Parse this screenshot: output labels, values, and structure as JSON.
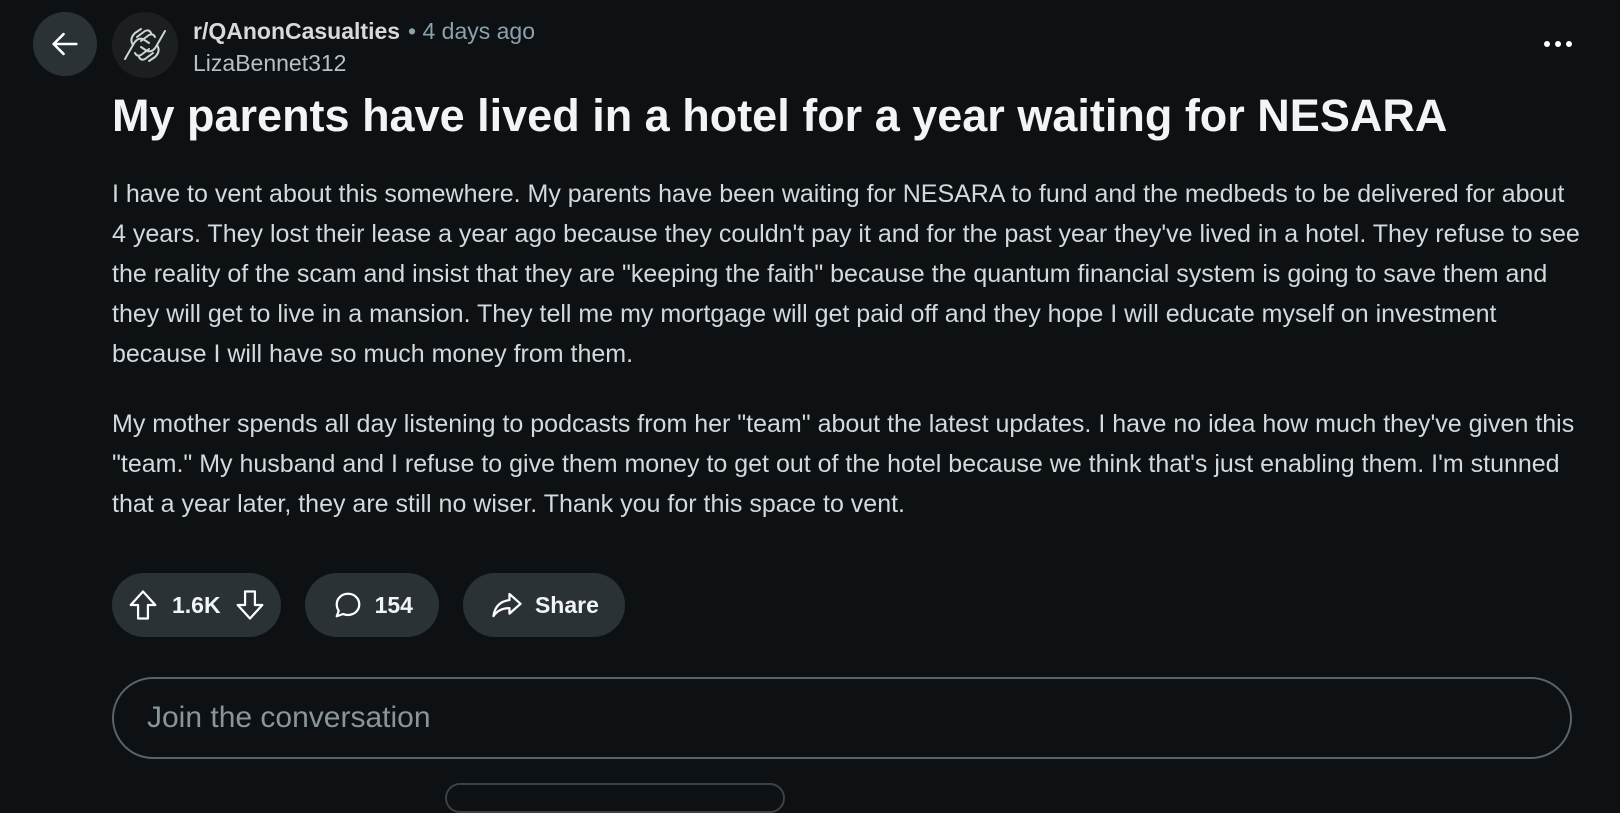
{
  "post": {
    "subreddit": "r/QAnonCasualties",
    "time": "• 4 days ago",
    "author": "LizaBennet312",
    "title": "My parents have lived in a hotel for a year waiting for NESARA",
    "paragraphs": [
      "I have to vent about this somewhere. My parents have been waiting for NESARA to fund and the medbeds to be delivered for about 4 years. They lost their lease a year ago because they couldn't pay it and for the past year they've lived in a hotel. They refuse to see the reality of the scam and insist that they are \"keeping the faith\" because the quantum financial system is going to save them and they will get to live in a mansion. They tell me my mortgage will get paid off and they hope I will educate myself on investment because I will have so much money from them.",
      "My mother spends all day listening to podcasts from her \"team\" about the latest updates. I have no idea how much they've given this \"team.\" My husband and I refuse to give them money to get out of the hotel because we think that's just enabling them. I'm stunned that a year later, they are still no wiser. Thank you for this space to vent."
    ]
  },
  "actions": {
    "votes": "1.6K",
    "comments": "154",
    "share_label": "Share"
  },
  "comment_input": {
    "placeholder": "Join the conversation"
  },
  "icons": {
    "back": "arrow-left-icon",
    "more": "more-horizontal-icon",
    "upvote": "upvote-arrow-icon",
    "downvote": "downvote-arrow-icon",
    "comment": "comment-bubble-icon",
    "share": "share-arrow-icon",
    "avatar": "hands-logo-icon"
  },
  "colors": {
    "background": "#0e1113",
    "pill": "#2a3236",
    "text": "#f2f4f5",
    "muted": "#8ba2ad"
  }
}
